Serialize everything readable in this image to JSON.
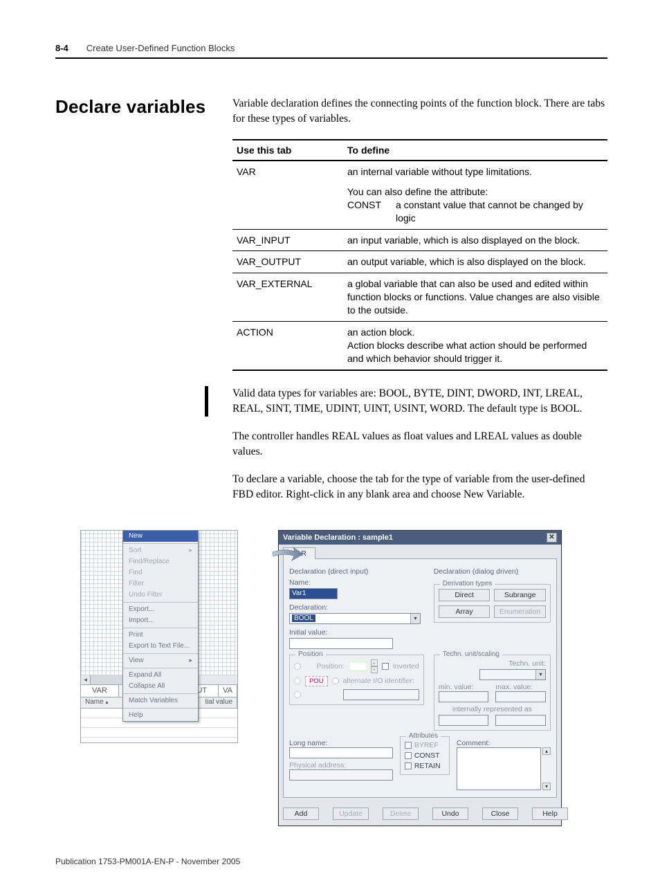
{
  "header": {
    "page_num": "8-4",
    "chapter": "Create User-Defined Function Blocks"
  },
  "section_title": "Declare variables",
  "intro": "Variable declaration defines the connecting points of the function block. There are tabs for these types of variables.",
  "table": {
    "head1": "Use this tab",
    "head2": "To define",
    "rows": [
      {
        "tab": "VAR",
        "def_a": "an internal variable without type limitations.",
        "def_b": "You can also define the attribute:",
        "attr_label": "CONST",
        "attr_text": "a constant value that cannot be changed by logic"
      },
      {
        "tab": "VAR_INPUT",
        "def_a": "an input variable, which is also displayed on the block."
      },
      {
        "tab": "VAR_OUTPUT",
        "def_a": "an output variable, which is also displayed on the block."
      },
      {
        "tab": "VAR_EXTERNAL",
        "def_a": "a global variable that can also be used and edited within function blocks or functions. Value changes are also visible to the outside."
      },
      {
        "tab": "ACTION",
        "def_a": "an action block.",
        "def_b": "Action blocks describe what action should be performed and which behavior should trigger it."
      }
    ]
  },
  "para_types": "Valid data types for variables are: BOOL, BYTE, DINT, DWORD, INT, LREAL, REAL, SINT, TIME, UDINT, UINT, USINT, WORD. The default type is BOOL.",
  "para_realnote": "The controller handles REAL values as float values and LREAL values as double values.",
  "para_howto": "To declare a variable, choose the tab for the type of variable from the user-defined FBD editor. Right-click in any blank area and choose New Variable.",
  "ctx": {
    "items": [
      "New",
      "Sort",
      "Find/Replace",
      "Find",
      "Filter",
      "Undo Filter",
      "Export...",
      "Import...",
      "Print",
      "Export to Text File...",
      "View",
      "Expand All",
      "Collapse All",
      "Match Variables",
      "Help"
    ],
    "tab_var": "VAR",
    "tab_output": "OUTPUT",
    "tab_va": "VA",
    "col_name": "Name",
    "col_value": "tial value"
  },
  "dlg": {
    "title": "Variable Declaration : sample1",
    "tab": "VAR",
    "decl_direct": "Declaration (direct input)",
    "decl_dialog": "Declaration (dialog driven)",
    "name_lbl": "Name:",
    "name_val": "Var1",
    "decl_lbl": "Declaration:",
    "decl_val": "BOOL",
    "init_lbl": "Initial value:",
    "deriv_title": "Derivation types",
    "btn_direct": "Direct",
    "btn_subrange": "Subrange",
    "btn_array": "Array",
    "btn_enum": "Enumeration",
    "grp_position": "Position",
    "pos_label": "Position:",
    "pos_inverted": "Inverted",
    "pos_pou": "POU",
    "pos_alt": "alternate I/O identifier:",
    "grp_techn": "Techn. unit/scaling",
    "techn_unit_lbl": "Techn. unit:",
    "min_lbl": "min. value:",
    "max_lbl": "max. value:",
    "internal_lbl": "internally represented as",
    "longname_lbl": "Long name:",
    "phys_lbl": "Physical address:",
    "grp_attr": "Attributes",
    "attr_byref": "BYREF",
    "attr_const": "CONST",
    "attr_retain": "RETAIN",
    "comment_lbl": "Comment:",
    "btn_add": "Add",
    "btn_update": "Update",
    "btn_delete": "Delete",
    "btn_undo": "Undo",
    "btn_close": "Close",
    "btn_help": "Help"
  },
  "footer": "Publication 1753-PM001A-EN-P - November 2005"
}
